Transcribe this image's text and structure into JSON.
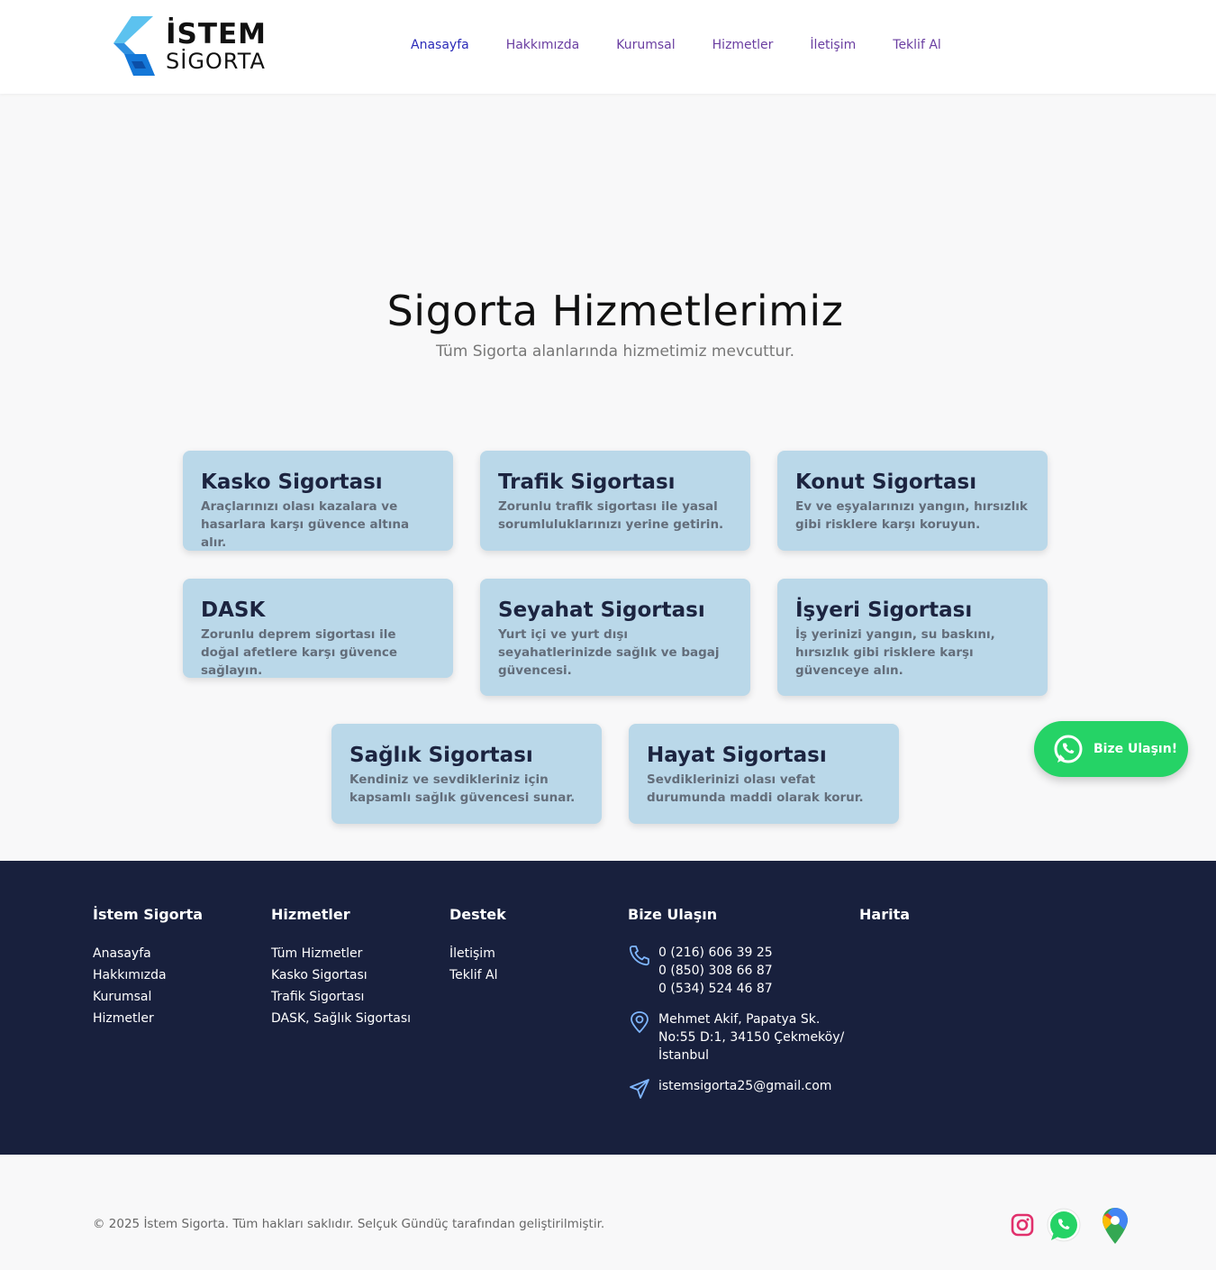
{
  "header": {
    "logo_line1": "İSTEM",
    "logo_line2": "SİGORTA",
    "nav": [
      "Anasayfa",
      "Hakkımızda",
      "Kurumsal",
      "Hizmetler",
      "İletişim",
      "Teklif Al"
    ]
  },
  "hero": {
    "title": "Sigorta Hizmetlerimiz",
    "subtitle": "Tüm Sigorta alanlarında hizmetimiz mevcuttur."
  },
  "services": [
    {
      "title": "Kasko Sigortası",
      "desc": "Araçlarınızı olası kazalara ve hasarlara karşı güvence altına alır."
    },
    {
      "title": "Trafik Sigortası",
      "desc": "Zorunlu trafik sigortası ile yasal sorumluluklarınızı yerine getirin."
    },
    {
      "title": "Konut Sigortası",
      "desc": "Ev ve eşyalarınızı yangın, hırsızlık gibi risklere karşı koruyun."
    },
    {
      "title": "DASK",
      "desc": "Zorunlu deprem sigortası ile doğal afetlere karşı güvence sağlayın."
    },
    {
      "title": "Seyahat Sigortası",
      "desc": "Yurt içi ve yurt dışı seyahatlerinizde sağlık ve bagaj güvencesi."
    },
    {
      "title": "İşyeri Sigortası",
      "desc": "İş yerinizi yangın, su baskını, hırsızlık gibi risklere karşı güvenceye alın."
    },
    {
      "title": "Sağlık Sigortası",
      "desc": "Kendiniz ve sevdikleriniz için kapsamlı sağlık güvencesi sunar."
    },
    {
      "title": "Hayat Sigortası",
      "desc": "Sevdiklerinizi olası vefat durumunda maddi olarak korur."
    }
  ],
  "whatsapp_button": {
    "label": "Bize Ulaşın!",
    "icon": "whatsapp-icon"
  },
  "footer": {
    "col1": {
      "title": "İstem Sigorta",
      "links": [
        "Anasayfa",
        "Hakkımızda",
        "Kurumsal",
        "Hizmetler"
      ]
    },
    "col2": {
      "title": "Hizmetler",
      "links": [
        "Tüm Hizmetler",
        "Kasko Sigortası",
        "Trafik Sigortası",
        "DASK, Sağlık Sigortası"
      ]
    },
    "col3": {
      "title": "Destek",
      "links": [
        "İletişim",
        "Teklif Al"
      ]
    },
    "col4": {
      "title": "Bize Ulaşın",
      "phones": [
        "0 (216) 606 39 25",
        "0 (850) 308 66 87",
        "0 (534) 524 46 87"
      ],
      "address": [
        "Mehmet Akif, Papatya Sk.",
        "No:55 D:1, 34150 Çekmeköy/",
        "İstanbul"
      ],
      "email": "istemsigorta25@gmail.com"
    },
    "col5": {
      "title": "Harita"
    }
  },
  "bottom": {
    "copyright": "© 2025 İstem Sigorta. Tüm hakları saklıdır. Selçuk Gündüç tarafından geliştirilmiştir.",
    "social_icons": [
      "instagram-icon",
      "whatsapp-icon",
      "google-maps-icon"
    ]
  },
  "colors": {
    "card_bg": "#bad8e9",
    "footer_bg": "#18203d",
    "nav_link": "#6a3ea1",
    "whatsapp_green": "#25d366"
  }
}
